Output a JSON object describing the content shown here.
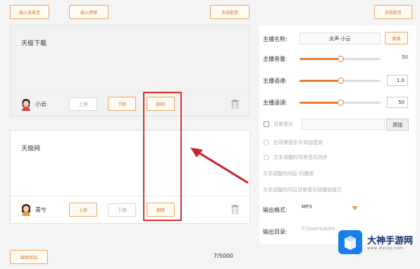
{
  "toolbar": {
    "btn1": "插入背景音",
    "btn2": "插入停顿",
    "btn3": "多段配音",
    "btn4": "多段配音"
  },
  "cards": [
    {
      "text": "天极下载",
      "speaker": "小云",
      "up": "上移",
      "down": "下移",
      "delete": "删除"
    },
    {
      "text": "天极网",
      "speaker": "青兮",
      "up": "上移",
      "down": "下移",
      "delete": "删除"
    }
  ],
  "bottom": {
    "add": "继续添加",
    "count": "7/5000"
  },
  "panel": {
    "anchor_label": "主播名称:",
    "anchor_value": "女声-小云",
    "anchor_btn": "更换",
    "volume_label": "主播音量:",
    "volume_value": "50",
    "volume": 0.5,
    "speed_label": "主播语速:",
    "speed_value": "1.0",
    "speed": 0.5,
    "pitch_label": "主播语调:",
    "pitch_value": "50",
    "pitch": 0.5,
    "bg_label": "背景音乐",
    "bg_add": "添加",
    "opt1": "在背景音乐中添加音效",
    "opt2": "文本调整时背景音乐同步",
    "opt3": "文本调整时间后 的播放",
    "opt4": "文本调整时间后背景音乐随播放提示",
    "format_label": "输出格式:",
    "format_value": "MP3",
    "dir_label": "输出目录:",
    "dir_value": "C:\\Users\\Adm"
  },
  "watermark": {
    "title": "大神手游网",
    "url": "www.dsssy.com"
  },
  "colors": {
    "accent": "#e57d35",
    "highlight": "#d93030",
    "arrow": "#c8252a",
    "logo": "#1a7ee8"
  }
}
